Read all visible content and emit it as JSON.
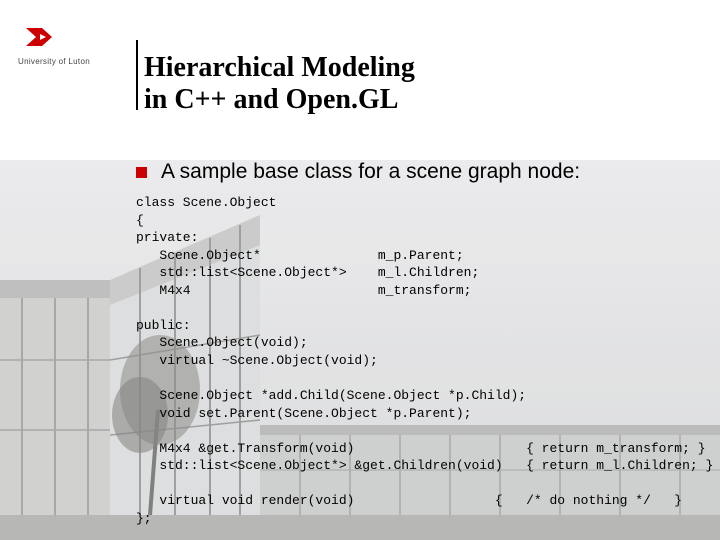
{
  "logo": {
    "text": "University of Luton"
  },
  "title": {
    "line1": "Hierarchical Modeling",
    "line2": "in C++ and Open.GL"
  },
  "bullet": {
    "text": "A sample base class for a scene graph node:"
  },
  "code": {
    "l01": "class Scene.Object",
    "l02": "{",
    "l03": "private:",
    "l04": "   Scene.Object*               m_p.Parent;",
    "l05": "   std::list<Scene.Object*>    m_l.Children;",
    "l06": "   M4x4                        m_transform;",
    "l07": "",
    "l08": "public:",
    "l09": "   Scene.Object(void);",
    "l10": "   virtual ~Scene.Object(void);",
    "l11": "",
    "l12": "   Scene.Object *add.Child(Scene.Object *p.Child);",
    "l13": "   void set.Parent(Scene.Object *p.Parent);",
    "l14": "",
    "l15": "   M4x4 &get.Transform(void)                      { return m_transform; }",
    "l16": "   std::list<Scene.Object*> &get.Children(void)   { return m_l.Children; }",
    "l17": "",
    "l18": "   virtual void render(void)                  {   /* do nothing */   }",
    "l19": "};"
  }
}
